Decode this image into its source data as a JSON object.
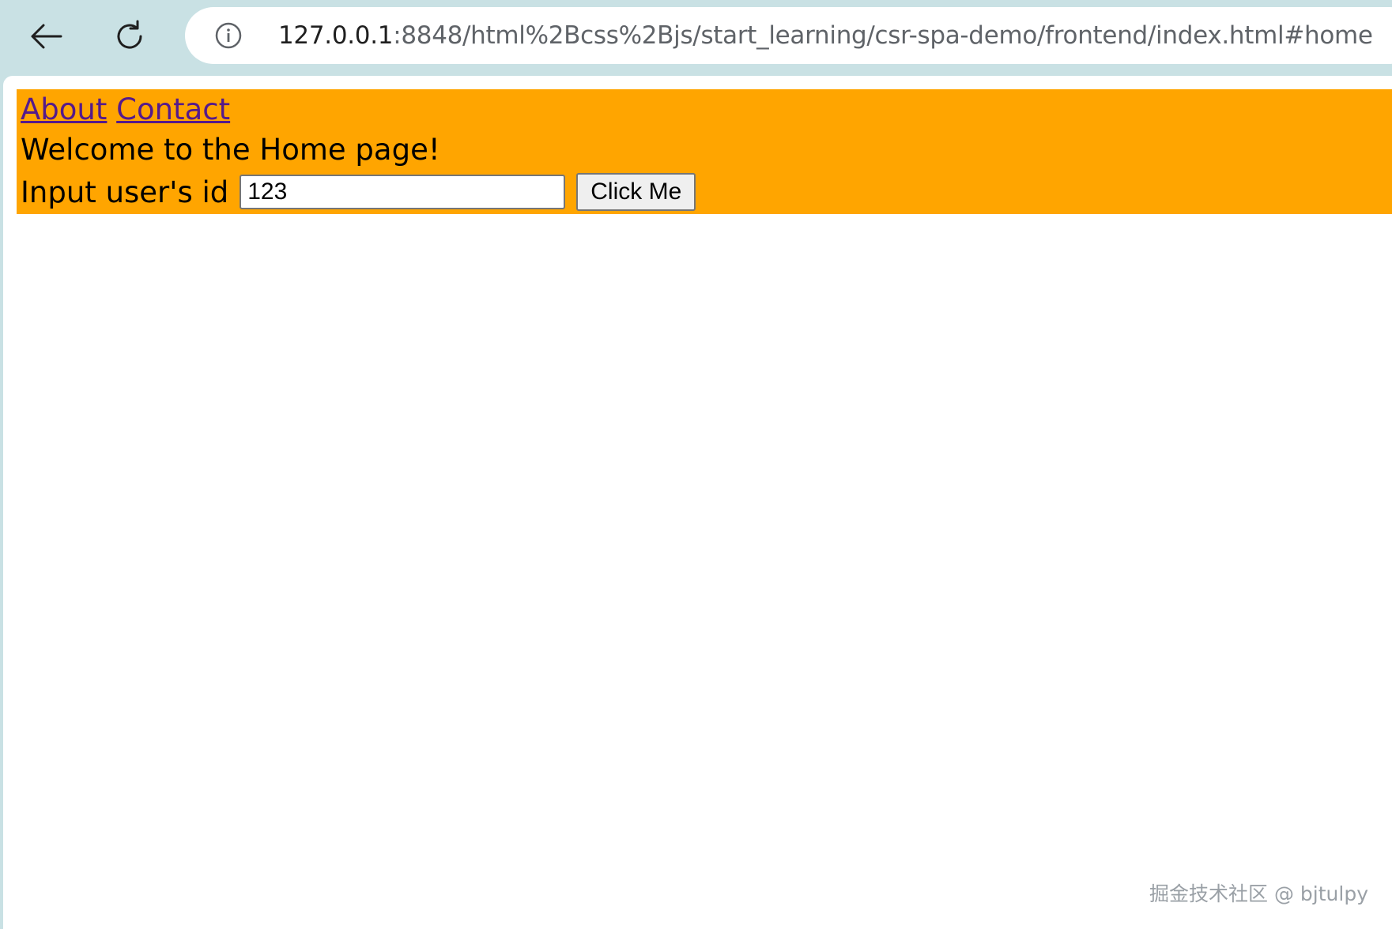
{
  "browser": {
    "back_icon": "arrow-left-icon",
    "reload_icon": "reload-icon",
    "site_info_icon": "info-icon",
    "url_host": "127.0.0.1",
    "url_rest": ":8848/html%2Bcss%2Bjs/start_learning/csr-spa-demo/frontend/index.html#home"
  },
  "page": {
    "nav_links": [
      "About",
      "Contact"
    ],
    "welcome_text": "Welcome to the Home page!",
    "input_label": "Input user's id",
    "input_value": "123",
    "button_label": "Click Me",
    "background_color": "#ffa500",
    "link_color": "#551a8b"
  },
  "watermark": "掘金技术社区 @ bjtulpy"
}
